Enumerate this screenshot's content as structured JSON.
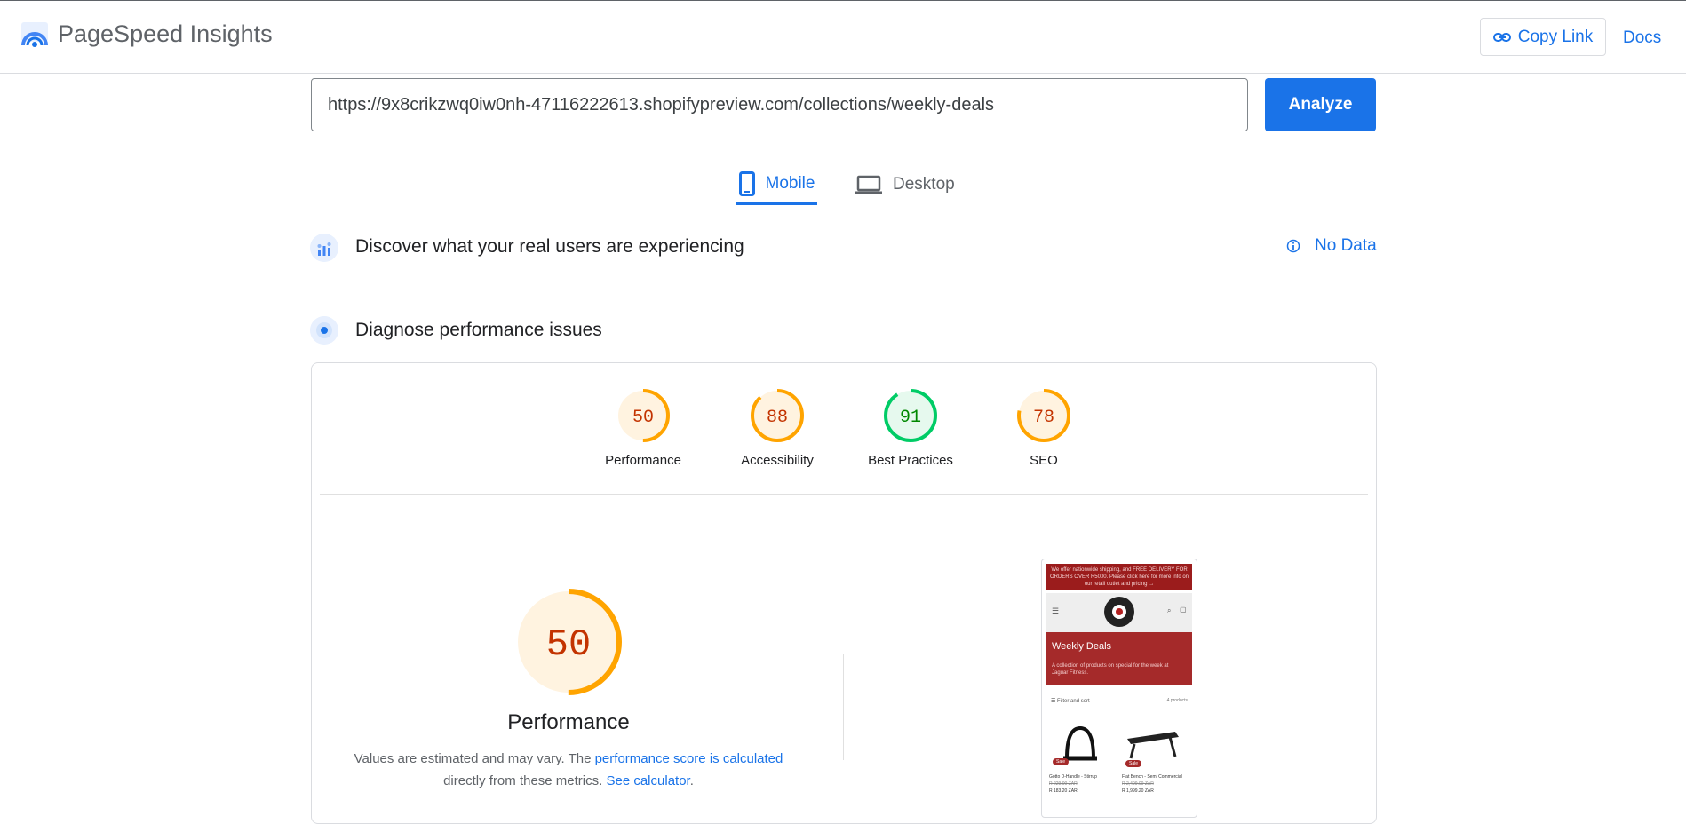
{
  "header": {
    "title": "PageSpeed Insights",
    "copy_link_label": "Copy Link",
    "docs_label": "Docs"
  },
  "search": {
    "url_value": "https://9x8crikzwq0iw0nh-47116222613.shopifypreview.com/collections/weekly-deals",
    "analyze_label": "Analyze"
  },
  "tabs": [
    {
      "label": "Mobile",
      "active": true
    },
    {
      "label": "Desktop",
      "active": false
    }
  ],
  "field_data": {
    "title": "Discover what your real users are experiencing",
    "status_label": "No Data"
  },
  "lab_data": {
    "title": "Diagnose performance issues"
  },
  "scores": [
    {
      "label": "Performance",
      "value": 50,
      "color": "#c33300",
      "ring": "#ffa400",
      "fill": "#fff3e0"
    },
    {
      "label": "Accessibility",
      "value": 88,
      "color": "#c33300",
      "ring": "#ffa400",
      "fill": "#fff3e0"
    },
    {
      "label": "Best Practices",
      "value": 91,
      "color": "#008800",
      "ring": "#00cc66",
      "fill": "#e6f9ee"
    },
    {
      "label": "SEO",
      "value": 78,
      "color": "#c33300",
      "ring": "#ffa400",
      "fill": "#fff3e0"
    }
  ],
  "performance_detail": {
    "score": "50",
    "label": "Performance",
    "desc_part1": "Values are estimated and may vary. The ",
    "desc_link1": "performance score is calculated",
    "desc_part2": " directly from these metrics. ",
    "desc_link2": "See calculator",
    "desc_end": "."
  },
  "screenshot_preview": {
    "announcement": "We offer nationwide shipping, and FREE DELIVERY FOR ORDERS OVER R5000. Please click here for more info on our retail outlet and pricing →",
    "banner_title": "Weekly Deals",
    "banner_text": "A collection of products on special for the week at Jaguar Fitness.",
    "filter_label": "Filter and sort",
    "product_count": "4 products",
    "products": [
      {
        "badge": "Sale",
        "name": "Gotto D-Handle - Stirrup",
        "old_price": "R 229.00 ZAR",
        "price": "R 183.20 ZAR"
      },
      {
        "badge": "Sale",
        "name": "Flat Bench - Semi Commercial",
        "old_price": "R 2,499.00 ZAR",
        "price": "R 1,999.20 ZAR"
      }
    ]
  },
  "colors": {
    "accent": "#1a73e8",
    "average": "#ffa400",
    "pass": "#00cc66"
  }
}
